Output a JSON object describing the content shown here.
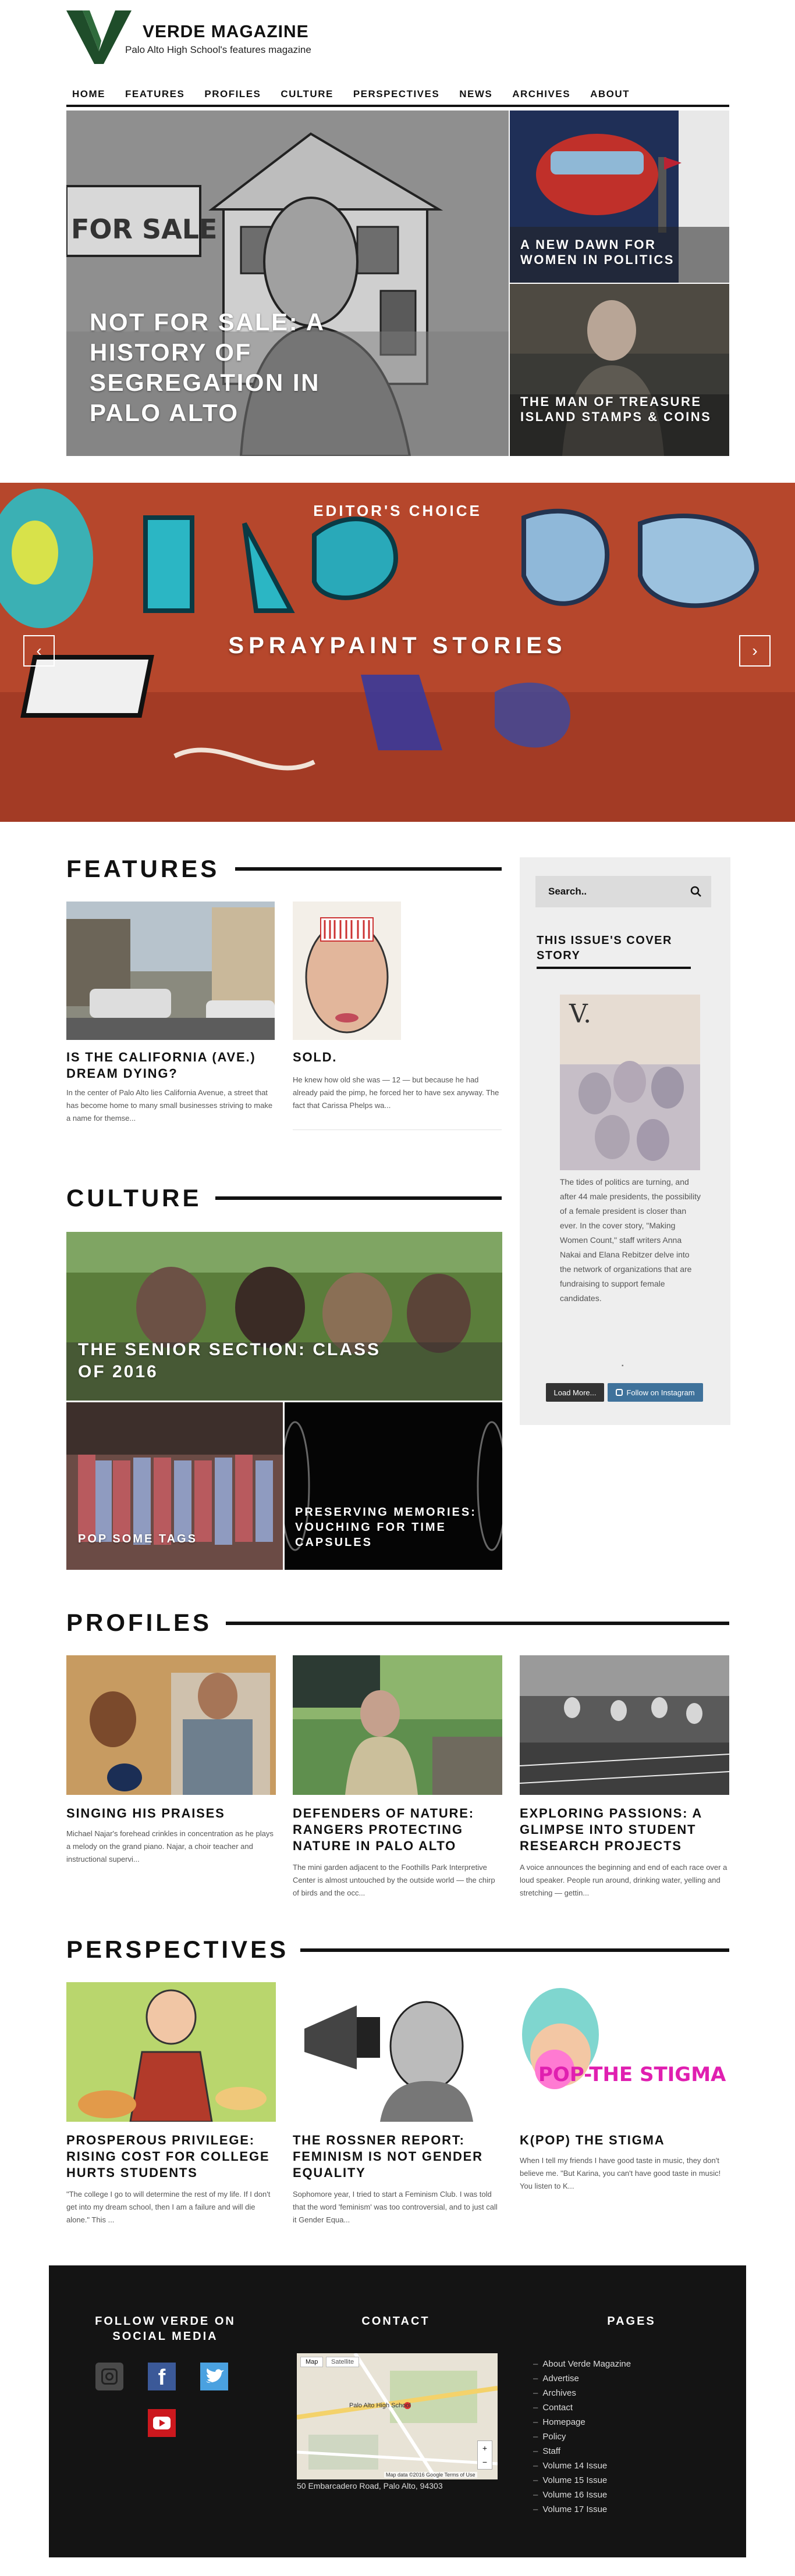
{
  "brand": {
    "title": "VERDE MAGAZINE",
    "subtitle": "Palo Alto High School's features magazine",
    "accent": "#1f4d2a"
  },
  "nav": [
    "HOME",
    "FEATURES",
    "PROFILES",
    "CULTURE",
    "PERSPECTIVES",
    "NEWS",
    "ARCHIVES",
    "ABOUT"
  ],
  "hero": {
    "main_title": "NOT FOR SALE: A HISTORY OF SEGREGATION IN PALO ALTO",
    "sign_text": "FOR SALE",
    "side1_title": "A NEW DAWN FOR WOMEN IN POLITICS",
    "side2_title": "THE MAN OF TREASURE ISLAND STAMPS & COINS"
  },
  "slider": {
    "label": "EDITOR'S CHOICE",
    "title": "SPRAYPAINT STORIES",
    "prev_icon": "chevron-left-icon",
    "next_icon": "chevron-right-icon"
  },
  "features": {
    "heading": "FEATURES",
    "items": [
      {
        "title": "IS THE CALIFORNIA (AVE.) DREAM DYING?",
        "excerpt": "In the center of Palo Alto lies California Avenue, a street that has become home to many small businesses striving to make a name for themse..."
      },
      {
        "title": "SOLD.",
        "excerpt": "He knew how old she was — 12 — but because he had already paid the pimp, he forced her to have sex anyway. The fact that Carissa Phelps wa..."
      }
    ]
  },
  "sidebar": {
    "search_placeholder": "Search..",
    "cover_heading": "THIS ISSUE'S COVER STORY",
    "cover_text": "The tides of politics are turning, and after 44 male presidents, the possibility of a female president is closer than ever. In the cover story, \"Making Women Count,\" staff writers Anna Nakai and Elana Rebitzer delve into the network of organizations that are fundraising to support female candidates.",
    "load_more": "Load More...",
    "follow_instagram": "Follow on Instagram"
  },
  "culture": {
    "heading": "CULTURE",
    "main_title": "THE SENIOR SECTION: CLASS OF 2016",
    "left_title": "POP SOME TAGS",
    "right_title": "PRESERVING MEMORIES: VOUCHING FOR TIME CAPSULES"
  },
  "profiles": {
    "heading": "PROFILES",
    "items": [
      {
        "title": "SINGING HIS PRAISES",
        "excerpt": "Michael Najar's forehead crinkles in concentration as he plays a melody on the grand piano. Najar, a choir teacher and instructional supervi..."
      },
      {
        "title": "DEFENDERS OF NATURE: RANGERS PROTECTING NATURE IN PALO ALTO",
        "excerpt": "The mini garden adjacent to the Foothills Park Interpretive Center is almost untouched by the outside world — the chirp of birds and the occ..."
      },
      {
        "title": "EXPLORING PASSIONS: A GLIMPSE INTO STUDENT RESEARCH PROJECTS",
        "excerpt": "A voice announces the beginning and end of each race over a loud speaker. People run around, drinking water, yelling and stretching — gettin..."
      }
    ]
  },
  "perspectives": {
    "heading": "PERSPECTIVES",
    "items": [
      {
        "title": "PROSPEROUS PRIVILEGE: RISING COST FOR COLLEGE HURTS STUDENTS",
        "excerpt": "\"The college I go to will determine the rest of my life. If I don't get into my dream school, then I am a failure and will die alone.\" This ..."
      },
      {
        "title": "THE ROSSNER REPORT: FEMINISM IS NOT GENDER EQUALITY",
        "excerpt": "Sophomore year, I tried to start a Feminism Club. I was told that the word 'feminism' was too controversial, and to just call it Gender Equa..."
      },
      {
        "title": "K(POP) THE STIGMA",
        "excerpt": "When I tell my friends I have good taste in music, they don't believe me. \"But Karina, you can't have good taste in music! You listen to K..."
      }
    ],
    "pop_text": "POP-THE STIGMA"
  },
  "footer": {
    "social_heading": "FOLLOW VERDE ON SOCIAL MEDIA",
    "social_icons": [
      "instagram-icon",
      "facebook-icon",
      "twitter-icon",
      "youtube-icon"
    ],
    "contact_heading": "CONTACT",
    "map_tabs": [
      "Map",
      "Satellite"
    ],
    "map_label": "Palo Alto High School",
    "map_footer": "Map data ©2016 Google   Terms of Use",
    "address": "50 Embarcadero Road, Palo Alto, 94303",
    "pages_heading": "PAGES",
    "pages": [
      "About Verde Magazine",
      "Advertise",
      "Archives",
      "Contact",
      "Homepage",
      "Policy",
      "Staff",
      "Volume 14 Issue",
      "Volume 15 Issue",
      "Volume 16 Issue",
      "Volume 17 Issue"
    ]
  }
}
